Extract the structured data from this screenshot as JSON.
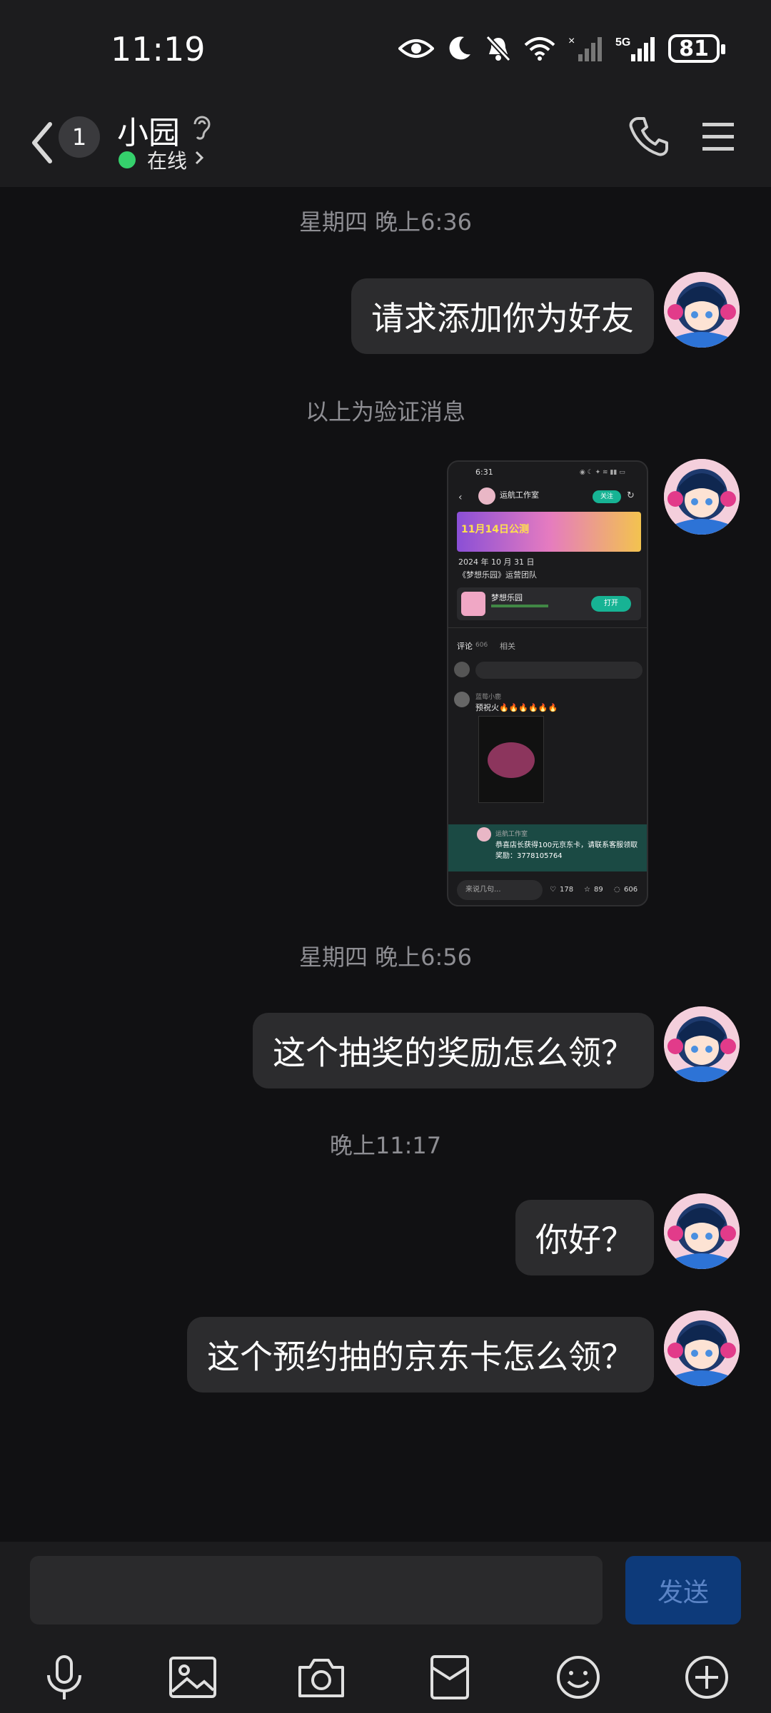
{
  "status_bar": {
    "time": "11:19",
    "battery": "81"
  },
  "header": {
    "unread_count": "1",
    "contact_name": "小园",
    "presence": "在线"
  },
  "messages": [
    {
      "timestamp": "星期四 晚上6:36"
    },
    {
      "text": "请求添加你为好友"
    },
    {
      "notice": "以上为验证消息"
    },
    {
      "screenshot": {
        "time": "6:31",
        "studio": "运航工作室",
        "follow": "关注",
        "banner": "11月14日公测",
        "date": "2024 年 10 月 31 日",
        "team": "《梦想乐园》运营团队",
        "app_name": "梦想乐园",
        "open": "打开",
        "comments_tab": "评论",
        "comments_count": "606",
        "related_tab": "相关",
        "input_placeholder": "来说几句...",
        "comment_user": "蓝莓小鹿",
        "comment_text": "预祝火🔥🔥🔥🔥🔥🔥",
        "reply_user": "运航工作室",
        "reply_text": "恭喜店长获得100元京东卡，请联系客服领取奖励：3778105764",
        "likes": "178",
        "stars": "89",
        "replies": "606"
      }
    },
    {
      "timestamp": "星期四 晚上6:56"
    },
    {
      "text": "这个抽奖的奖励怎么领？"
    },
    {
      "timestamp": "晚上11:17"
    },
    {
      "text": "你好？"
    },
    {
      "text": "这个预约抽的京东卡怎么领？"
    }
  ],
  "composer": {
    "send_label": "发送"
  }
}
